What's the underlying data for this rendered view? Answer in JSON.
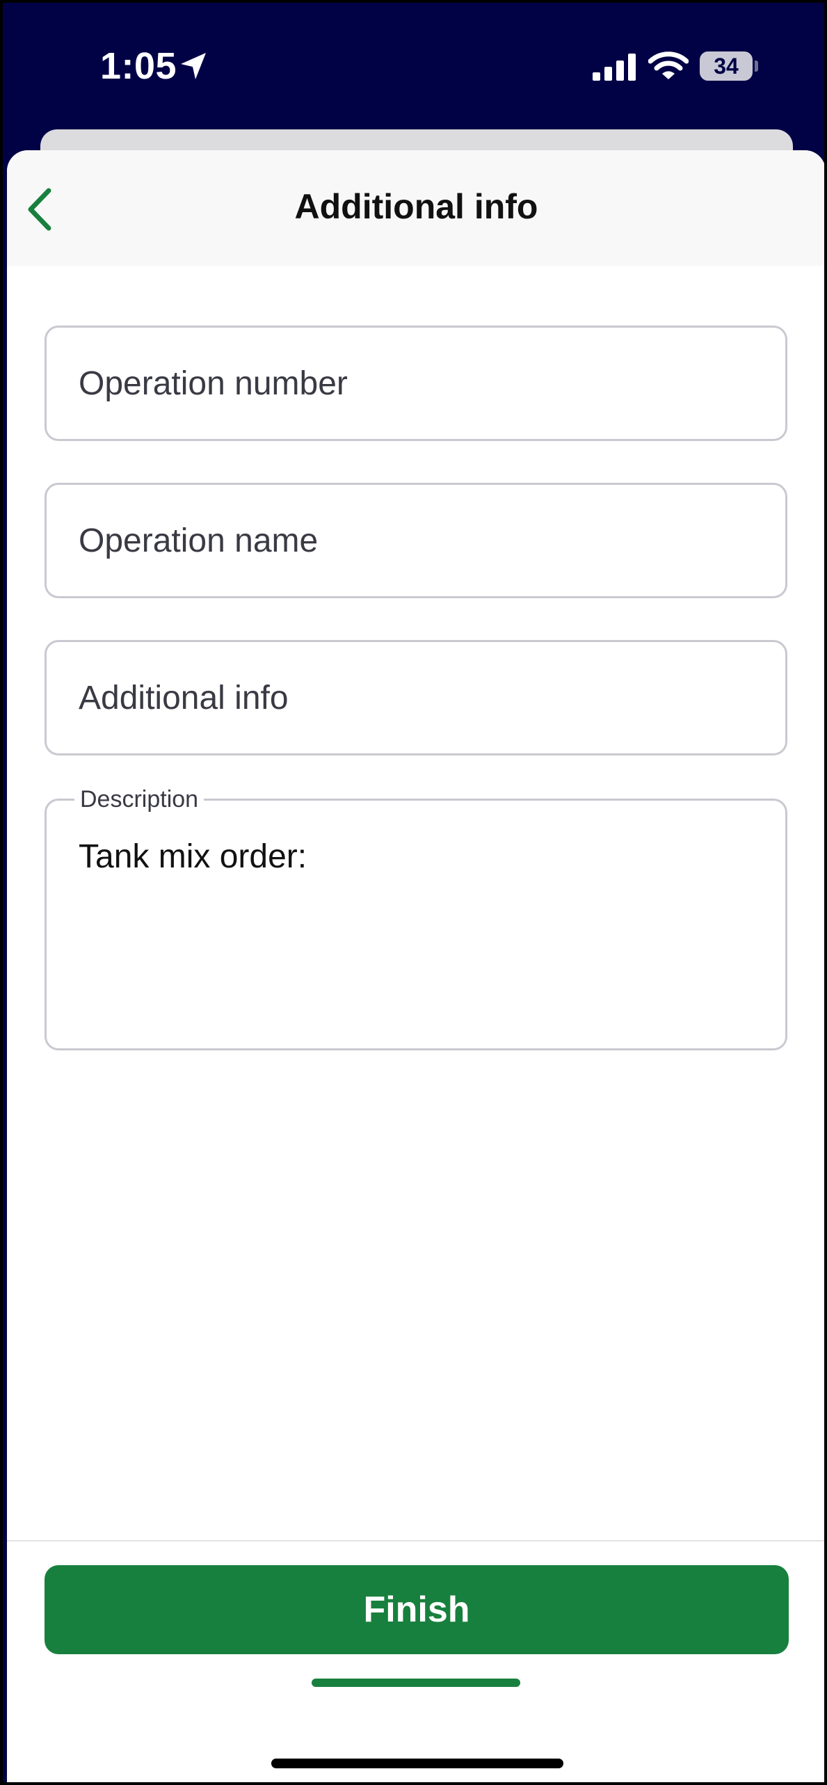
{
  "status_bar": {
    "time": "1:05",
    "battery": "34"
  },
  "nav": {
    "title": "Additional info"
  },
  "form": {
    "operation_number_placeholder": "Operation number",
    "operation_name_placeholder": "Operation name",
    "additional_info_placeholder": "Additional info",
    "description_label": "Description",
    "description_value": "Tank mix order:"
  },
  "footer": {
    "finish_label": "Finish"
  },
  "colors": {
    "status_bar_bg": "#010246",
    "accent": "#18803e"
  }
}
